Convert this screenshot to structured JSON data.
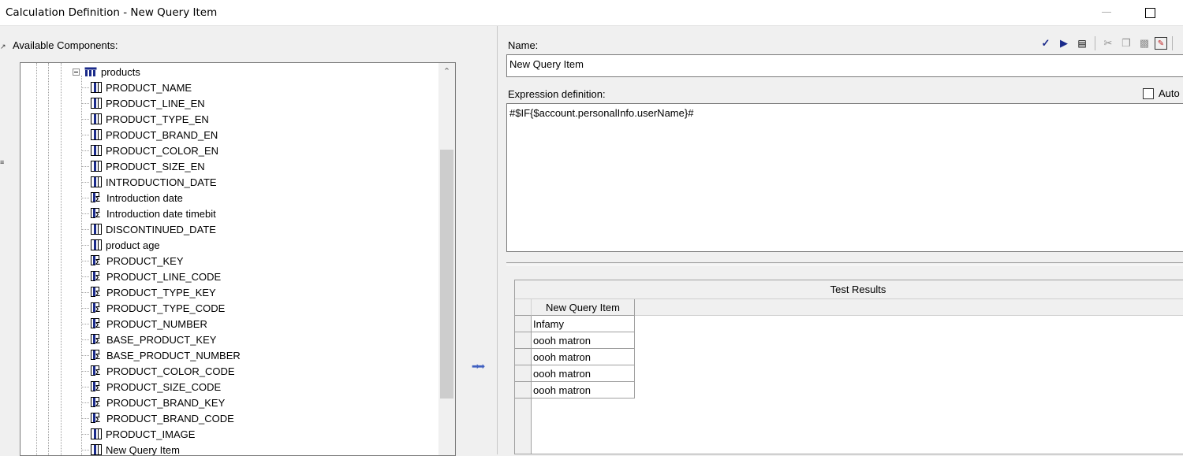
{
  "window": {
    "title": "Calculation Definition - New Query Item"
  },
  "left_panel": {
    "label": "Available Components:",
    "tree": {
      "parent": "products",
      "items": [
        {
          "label": "PRODUCT_NAME",
          "icon": "column-icon"
        },
        {
          "label": "PRODUCT_LINE_EN",
          "icon": "column-icon"
        },
        {
          "label": "PRODUCT_TYPE_EN",
          "icon": "column-icon"
        },
        {
          "label": "PRODUCT_BRAND_EN",
          "icon": "column-icon"
        },
        {
          "label": "PRODUCT_COLOR_EN",
          "icon": "column-icon"
        },
        {
          "label": "PRODUCT_SIZE_EN",
          "icon": "column-icon"
        },
        {
          "label": "INTRODUCTION_DATE",
          "icon": "column-icon"
        },
        {
          "label": "Introduction date",
          "icon": "calculated-column-icon"
        },
        {
          "label": "Introduction date timebit",
          "icon": "calculated-column-icon"
        },
        {
          "label": "DISCONTINUED_DATE",
          "icon": "column-icon"
        },
        {
          "label": "product age",
          "icon": "column-icon"
        },
        {
          "label": "PRODUCT_KEY",
          "icon": "calculated-column-icon"
        },
        {
          "label": "PRODUCT_LINE_CODE",
          "icon": "calculated-column-icon"
        },
        {
          "label": "PRODUCT_TYPE_KEY",
          "icon": "calculated-column-icon"
        },
        {
          "label": "PRODUCT_TYPE_CODE",
          "icon": "calculated-column-icon"
        },
        {
          "label": "PRODUCT_NUMBER",
          "icon": "calculated-column-icon"
        },
        {
          "label": "BASE_PRODUCT_KEY",
          "icon": "calculated-column-icon"
        },
        {
          "label": "BASE_PRODUCT_NUMBER",
          "icon": "calculated-column-icon"
        },
        {
          "label": "PRODUCT_COLOR_CODE",
          "icon": "calculated-column-icon"
        },
        {
          "label": "PRODUCT_SIZE_CODE",
          "icon": "calculated-column-icon"
        },
        {
          "label": "PRODUCT_BRAND_KEY",
          "icon": "calculated-column-icon"
        },
        {
          "label": "PRODUCT_BRAND_CODE",
          "icon": "calculated-column-icon"
        },
        {
          "label": "PRODUCT_IMAGE",
          "icon": "column-icon"
        },
        {
          "label": "New Query Item",
          "icon": "column-icon"
        }
      ]
    }
  },
  "right_panel": {
    "name_label": "Name:",
    "name_value": "New Query Item",
    "expression_label": "Expression definition:",
    "auto_label": "Auto",
    "expression_value": "#$IF{$account.personalInfo.userName}#",
    "toolbar": [
      "validate-icon",
      "run-icon",
      "properties-icon",
      "cut-icon",
      "copy-icon",
      "paste-icon",
      "clear-icon"
    ],
    "results": {
      "title": "Test Results",
      "column": "New Query Item",
      "rows": [
        "Infamy",
        "oooh matron",
        "oooh matron",
        "oooh matron",
        "oooh matron"
      ]
    }
  }
}
